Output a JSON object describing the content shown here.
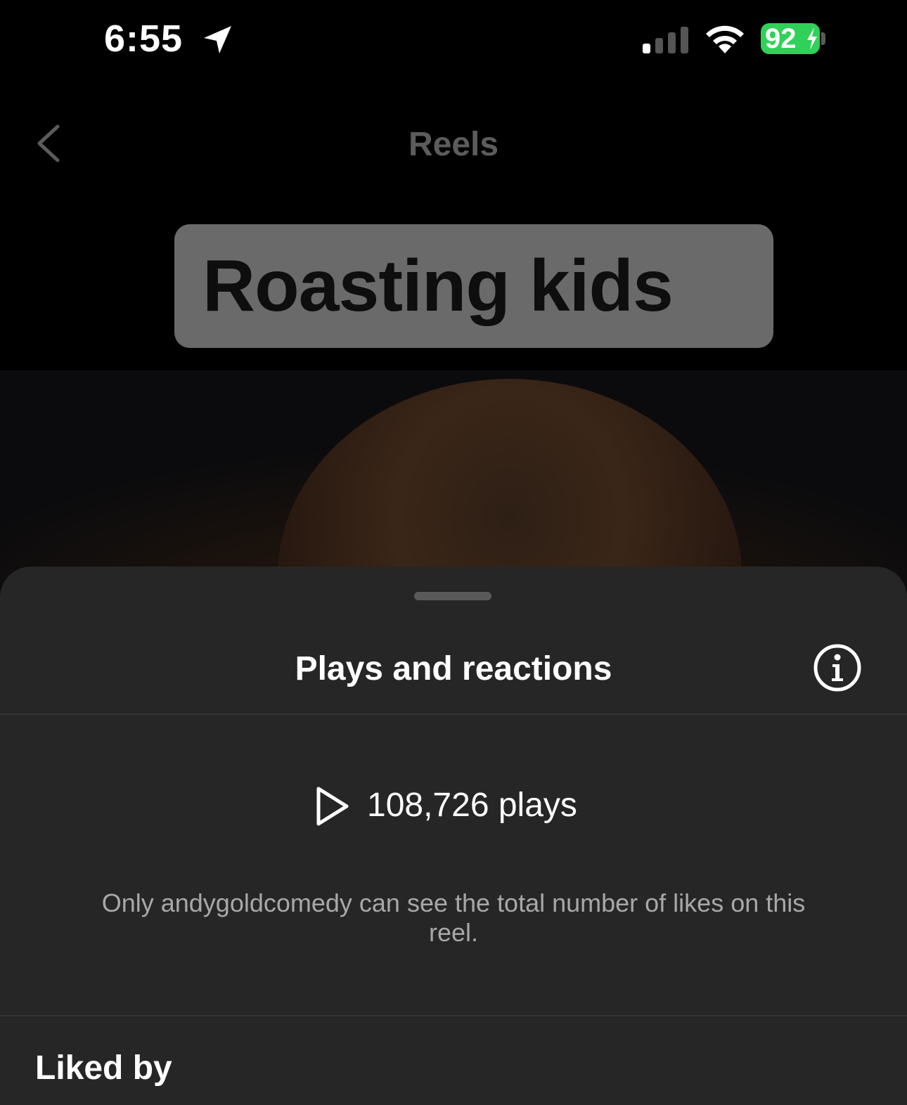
{
  "status_bar": {
    "time": "6:55",
    "battery": "92",
    "battery_color": "#30d158",
    "icons": [
      "location-arrow-icon",
      "signal-bars-icon",
      "wifi-icon",
      "battery-icon",
      "charging-bolt-icon"
    ]
  },
  "nav": {
    "title": "Reels",
    "back_icon": "chevron-left-icon"
  },
  "video": {
    "caption": "Roasting kids"
  },
  "sheet": {
    "title": "Plays and reactions",
    "info_icon": "info-circle-icon",
    "plays_icon": "play-outline-icon",
    "plays": "108,726 plays",
    "note": "Only andygoldcomedy can see the total number of likes on this reel.",
    "liked_by": "Liked by"
  }
}
